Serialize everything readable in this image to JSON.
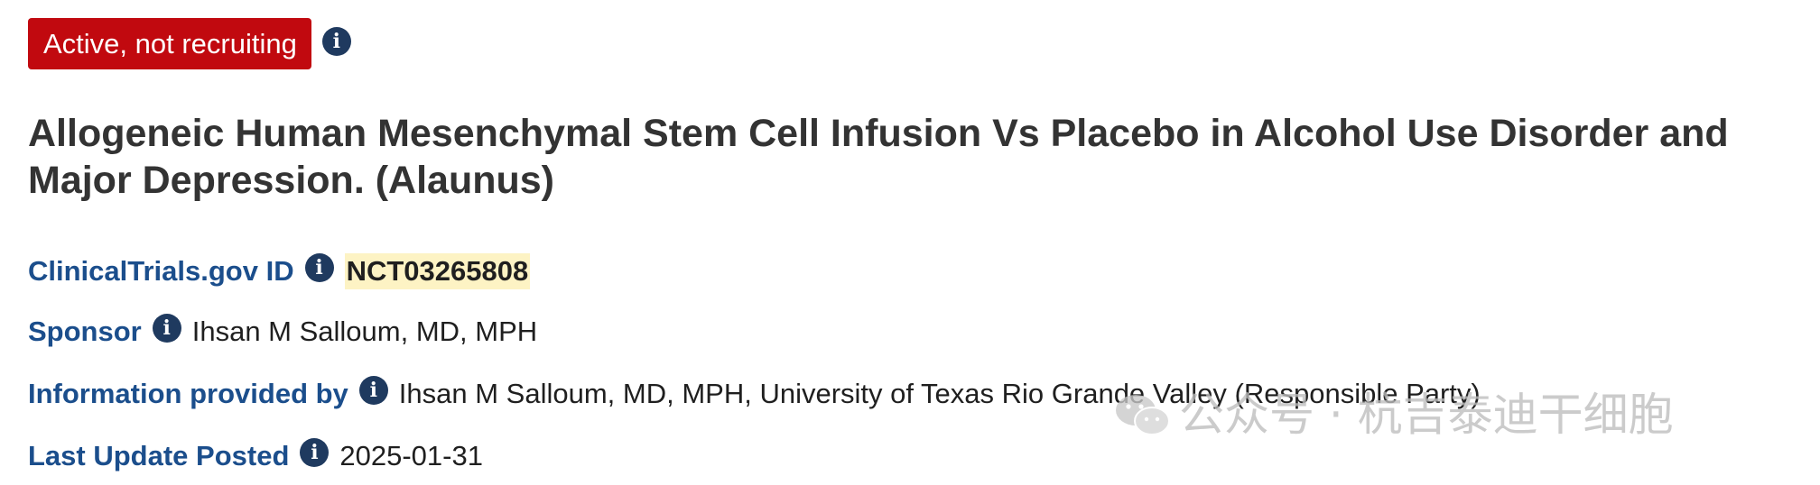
{
  "status": {
    "badge_text": "Active, not recruiting",
    "badge_color": "#c1090f"
  },
  "study": {
    "title": "Allogeneic Human Mesenchymal Stem Cell Infusion Vs Placebo in Alcohol Use Disorder and Major Depression. (Alaunus)"
  },
  "details": {
    "id_label": "ClinicalTrials.gov ID",
    "id_value": "NCT03265808",
    "sponsor_label": "Sponsor",
    "sponsor_value": "Ihsan M Salloum, MD, MPH",
    "info_label": "Information provided by",
    "info_value": "Ihsan M Salloum, MD, MPH, University of Texas Rio Grande Valley (Responsible Party)",
    "update_label": "Last Update Posted",
    "update_value": "2025-01-31"
  },
  "icons": {
    "info": "info-icon",
    "info_glyph": "i",
    "watermark_logo": "wechat-logo"
  },
  "colors": {
    "label_blue": "#1b4e8c",
    "icon_navy": "#1f3a5f",
    "highlight": "#fdf3c4",
    "title_text": "#333333"
  },
  "watermark": {
    "text": "公众号 · 杭吉泰迪干细胞"
  }
}
